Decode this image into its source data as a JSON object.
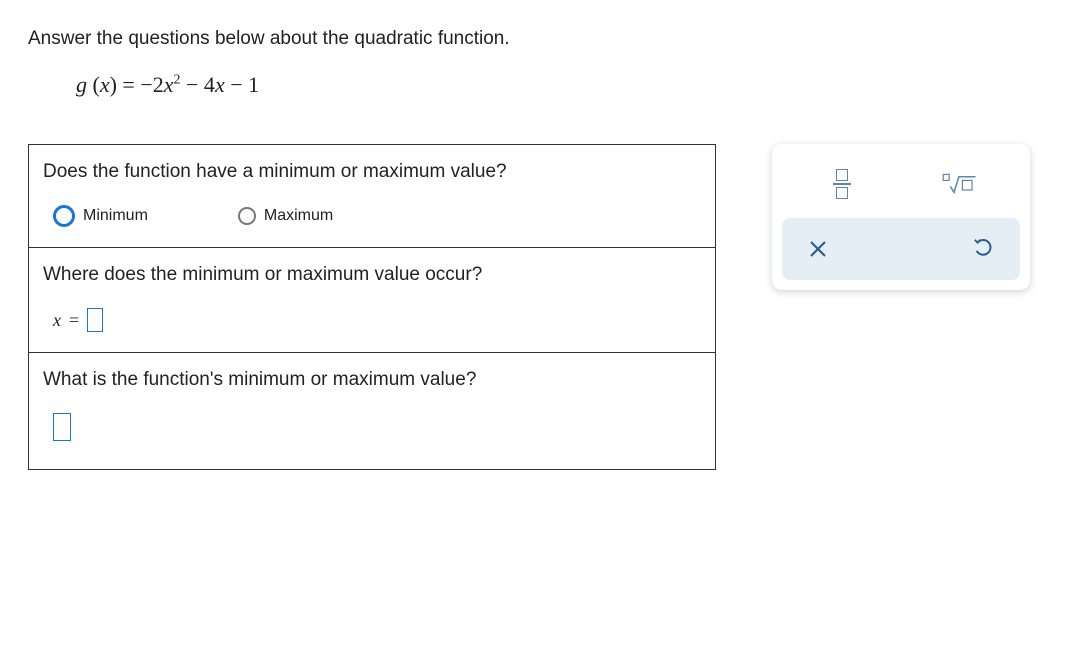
{
  "instruction": "Answer the questions below about the quadratic function.",
  "equation": {
    "fn": "g",
    "arg": "x",
    "rhs_a": "−2",
    "rhs_var": "x",
    "rhs_exp": "2",
    "rhs_b": " − 4",
    "rhs_var2": "x",
    "rhs_c": " − 1"
  },
  "q1": {
    "prompt": "Does the function have a minimum or maximum value?",
    "options": {
      "min": "Minimum",
      "max": "Maximum"
    },
    "selected": "min"
  },
  "q2": {
    "prompt": "Where does the minimum or maximum value occur?",
    "var_label": "x",
    "equals": "="
  },
  "q3": {
    "prompt": "What is the function's minimum or maximum value?"
  },
  "palette": {
    "fraction_tool": "fraction",
    "root_tool": "nth-root",
    "clear_tool": "clear",
    "undo_tool": "undo"
  }
}
